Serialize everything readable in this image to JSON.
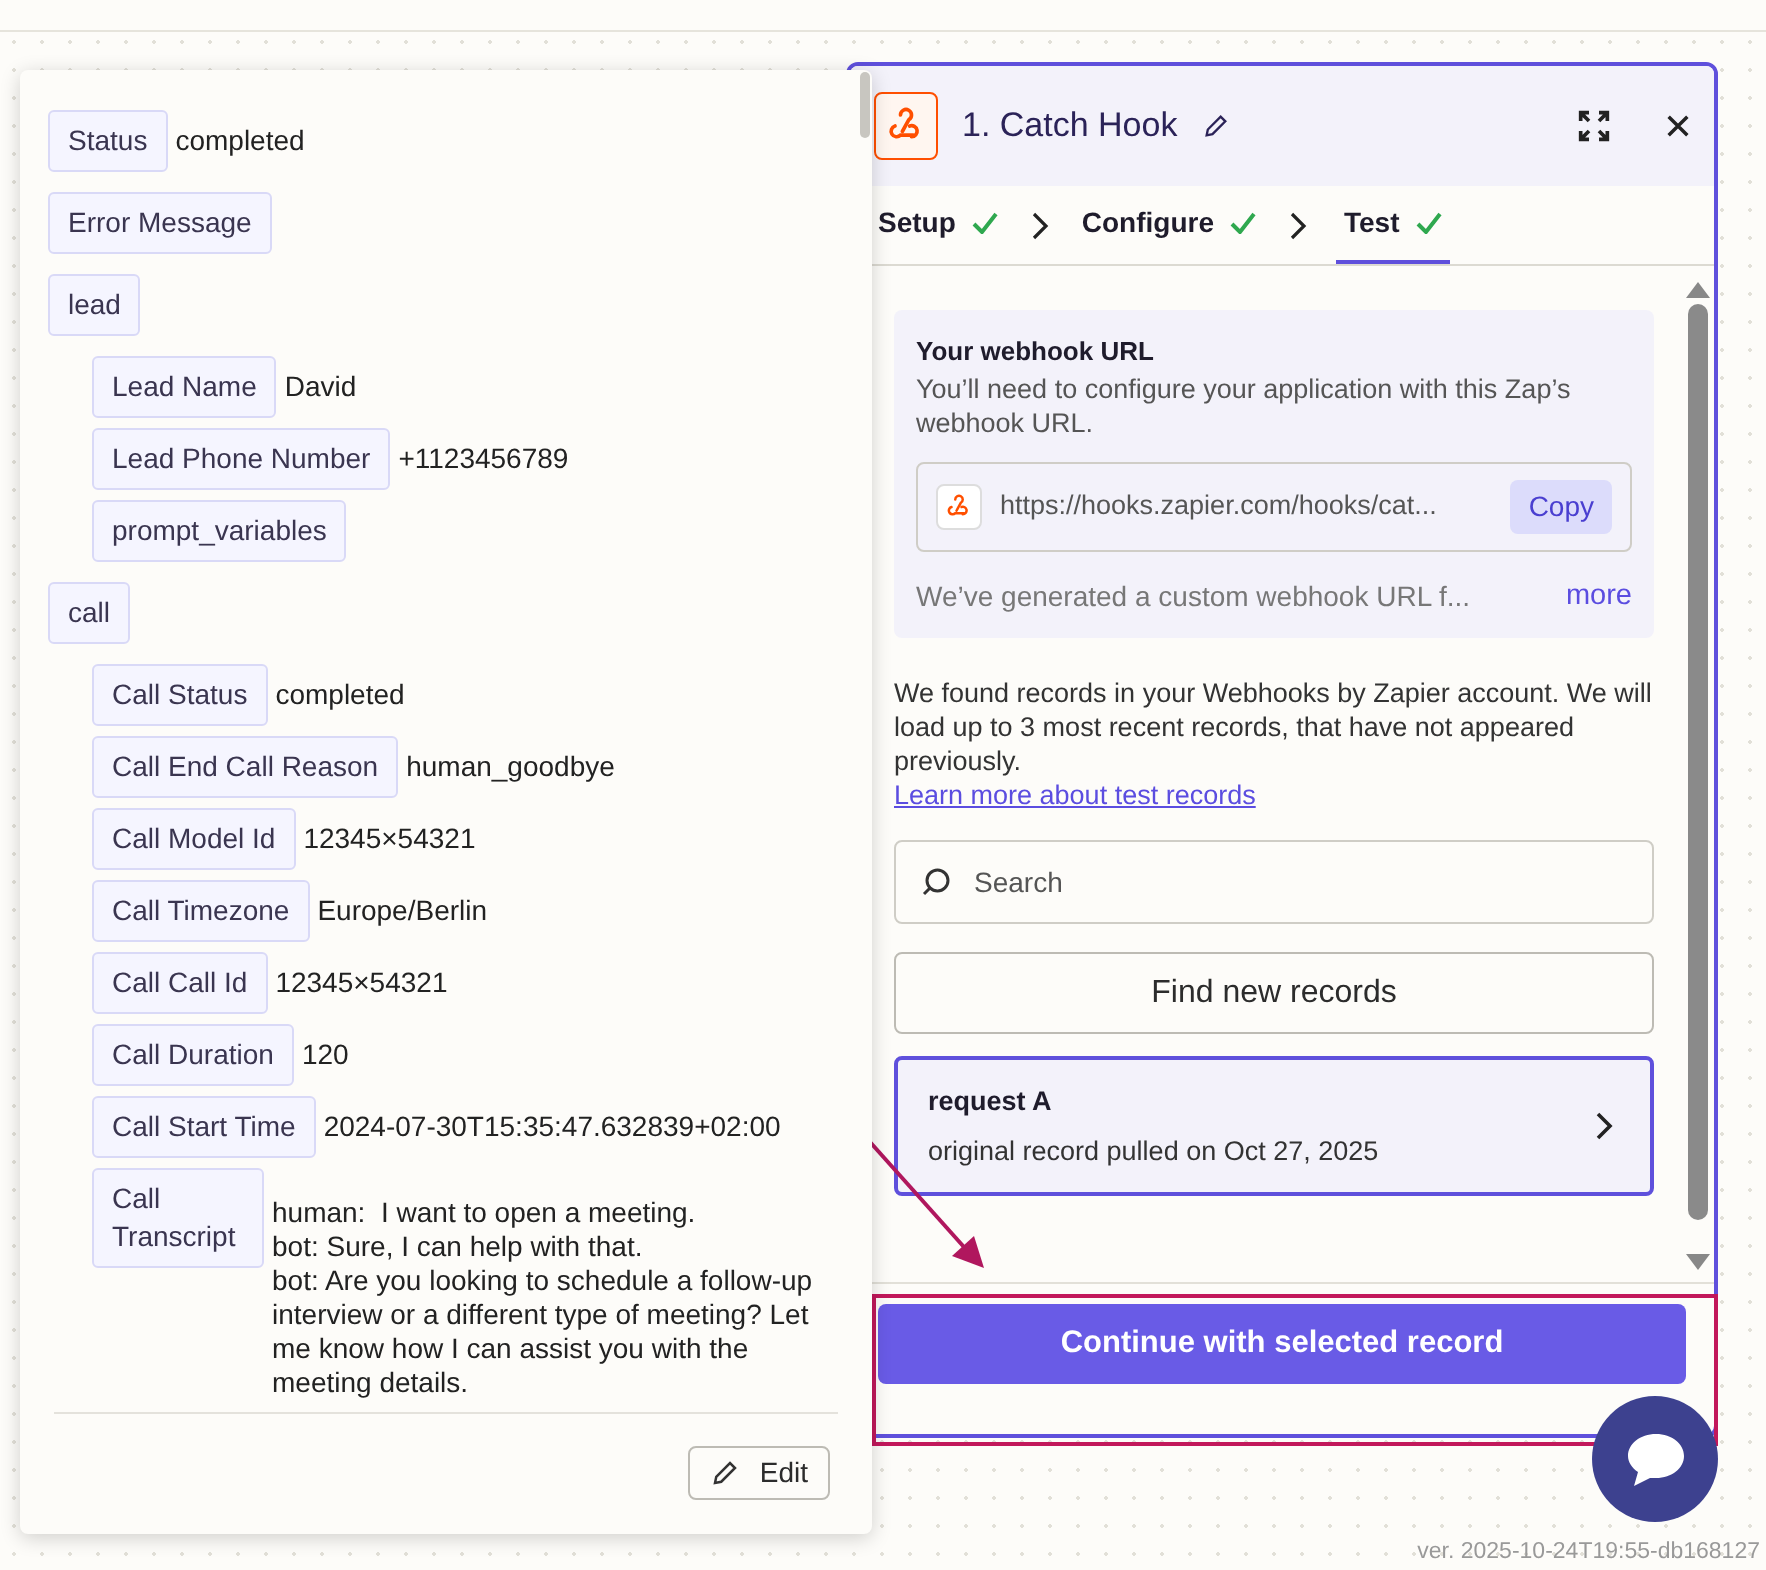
{
  "record_popover": {
    "fields": [
      {
        "label": "Status",
        "value": "completed"
      },
      {
        "label": "Error Message"
      },
      {
        "label": "lead",
        "children": [
          {
            "label": "Lead Name",
            "value": "David"
          },
          {
            "label": "Lead Phone Number",
            "value": "+1123456789"
          },
          {
            "label": "prompt_variables"
          }
        ]
      },
      {
        "label": "call",
        "children": [
          {
            "label": "Call Status",
            "value": "completed"
          },
          {
            "label": "Call End Call Reason",
            "value": "human_goodbye"
          },
          {
            "label": "Call Model Id",
            "value": "12345×54321"
          },
          {
            "label": "Call Timezone",
            "value": "Europe/Berlin"
          },
          {
            "label": "Call Call Id",
            "value": "12345×54321"
          },
          {
            "label": "Call Duration",
            "value": "120"
          },
          {
            "label": "Call Start Time",
            "value": "2024-07-30T15:35:47.632839+02:00"
          },
          {
            "label": "Call Transcript",
            "value": "human:  I want to open a meeting.\nbot: Sure, I can help with that.\nbot: Are you looking to schedule a follow-up interview or a different type of meeting? Let me know how I can assist you with the meeting details."
          }
        ]
      }
    ],
    "edit_button": "Edit"
  },
  "step_panel": {
    "title": "1. Catch Hook",
    "tabs": [
      {
        "label": "Setup",
        "done": true,
        "selected": false
      },
      {
        "label": "Configure",
        "done": true,
        "selected": false
      },
      {
        "label": "Test",
        "done": true,
        "selected": true
      }
    ],
    "webhook": {
      "heading": "Your webhook URL",
      "description": "You’ll need to configure your application with this Zap’s webhook URL.",
      "url": "https://hooks.zapier.com/hooks/cat...",
      "copy_button": "Copy",
      "note": "We’ve generated a custom webhook URL f...",
      "more_link": "more"
    },
    "found_text": "We found records in your Webhooks by Zapier account. We will load up to 3 most recent records, that have not appeared previously.",
    "learn_link": "Learn more about test records",
    "search": {
      "placeholder": "Search"
    },
    "find_button": "Find new records",
    "records": [
      {
        "title": "request A",
        "subtitle": "original record pulled on Oct 27, 2025",
        "selected": true
      }
    ],
    "continue_button": "Continue with selected record"
  },
  "version": "ver. 2025-10-24T19:55-db168127"
}
